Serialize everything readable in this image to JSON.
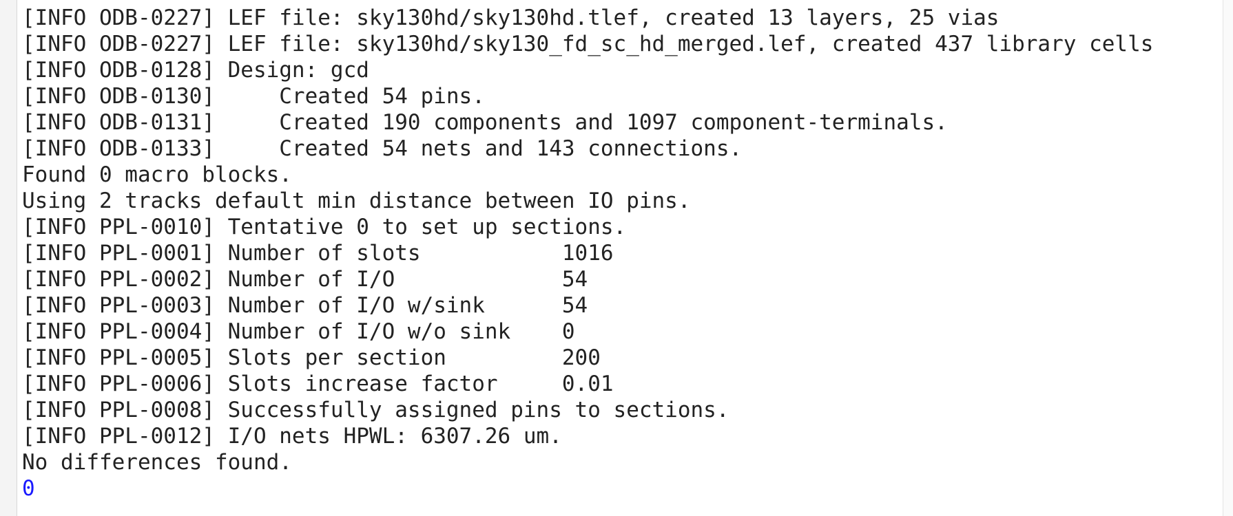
{
  "console": {
    "top_fragment": "",
    "lines": [
      "[INFO ODB-0227] LEF file: sky130hd/sky130hd.tlef, created 13 layers, 25 vias",
      "[INFO ODB-0227] LEF file: sky130hd/sky130_fd_sc_hd_merged.lef, created 437 library cells",
      "[INFO ODB-0128] Design: gcd",
      "[INFO ODB-0130]     Created 54 pins.",
      "[INFO ODB-0131]     Created 190 components and 1097 component-terminals.",
      "[INFO ODB-0133]     Created 54 nets and 143 connections.",
      "Found 0 macro blocks.",
      "Using 2 tracks default min distance between IO pins.",
      "[INFO PPL-0010] Tentative 0 to set up sections.",
      "[INFO PPL-0001] Number of slots           1016",
      "[INFO PPL-0002] Number of I/O             54",
      "[INFO PPL-0003] Number of I/O w/sink      54",
      "[INFO PPL-0004] Number of I/O w/o sink    0",
      "[INFO PPL-0005] Slots per section         200",
      "[INFO PPL-0006] Slots increase factor     0.01",
      "[INFO PPL-0008] Successfully assigned pins to sections.",
      "[INFO PPL-0012] I/O nets HPWL: 6307.26 um.",
      "No differences found."
    ],
    "result": "0",
    "result_color": "#1a1aff",
    "text_color": "#222222",
    "background": "#ffffff"
  }
}
